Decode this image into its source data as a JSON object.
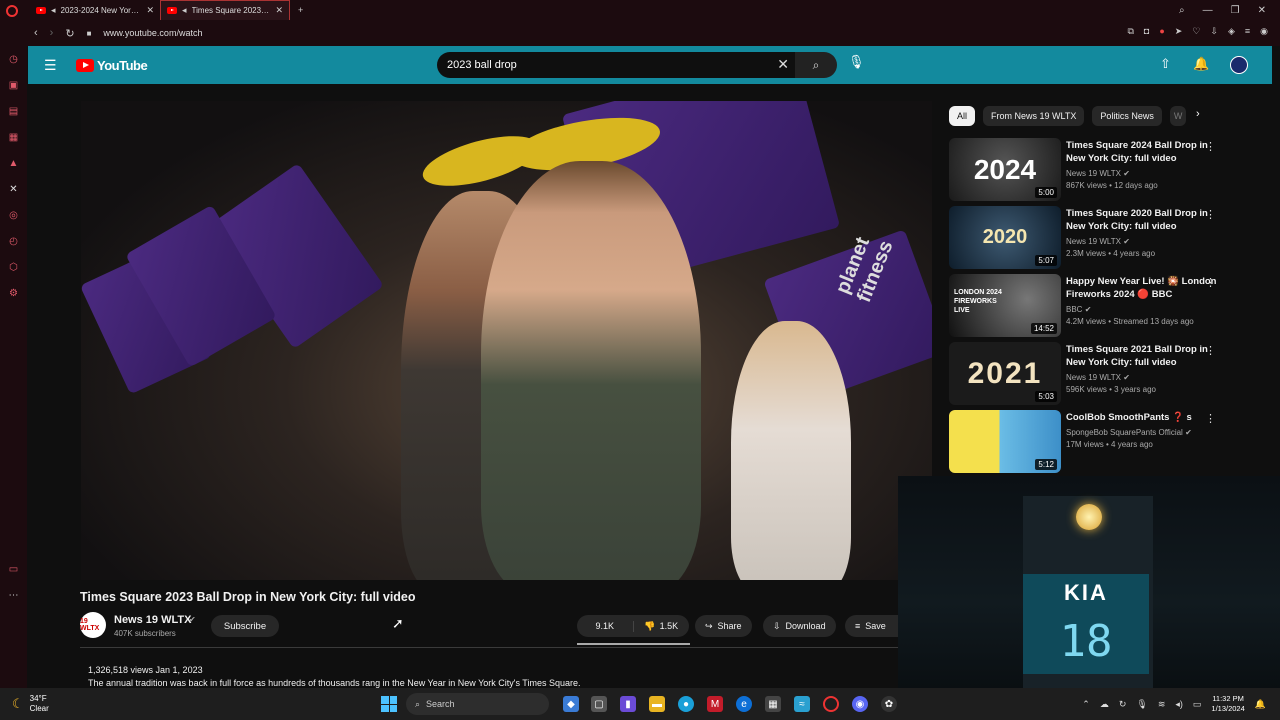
{
  "browser": {
    "tabs": [
      {
        "title": "2023-2024 New York City",
        "active": false
      },
      {
        "title": "Times Square 2023 Ball",
        "active": true
      }
    ],
    "new_tab": "+",
    "url": "www.youtube.com/watch"
  },
  "youtube": {
    "logo_text": "YouTube",
    "search_value": "2023 ball drop",
    "video": {
      "title": "Times Square 2023 Ball Drop in New York City: full video",
      "player_caption": "planet fitness",
      "channel": "News 19 WLTX",
      "channel_avatar_text": "19 WLTX",
      "subscribers": "407K subscribers",
      "subscribe_label": "Subscribe",
      "likes": "9.1K",
      "dislikes": "1.5K",
      "share_label": "Share",
      "download_label": "Download",
      "save_label": "Save",
      "views_date": "1,326,518 views  Jan 1, 2023",
      "description": "The annual tradition was back in full force as hundreds of thousands rang in the New Year in New York City's Times Square."
    },
    "chips": [
      "All",
      "From News 19 WLTX",
      "Politics News",
      "W"
    ],
    "recommendations": [
      {
        "title": "Times Square 2024 Ball Drop in New York City: full video",
        "channel": "News 19 WLTX",
        "meta": "867K views • 12 days ago",
        "duration": "5:00",
        "thumb_text": "2024",
        "thumb_color": "#2b2a2c"
      },
      {
        "title": "Times Square 2020 Ball Drop in New York City: full video",
        "channel": "News 19 WLTX",
        "meta": "2.3M views • 4 years ago",
        "duration": "5:07",
        "thumb_text": "2020",
        "thumb_color": "#1e3c57"
      },
      {
        "title": "Happy New Year Live! 🎇 London Fireworks 2024 🔴 BBC",
        "channel": "BBC",
        "meta": "4.2M views • Streamed 13 days ago",
        "duration": "14:52",
        "thumb_text": "LONDON 2024 FIREWORKS LIVE",
        "thumb_color": "#151515"
      },
      {
        "title": "Times Square 2021 Ball Drop in New York City: full video",
        "channel": "News 19 WLTX",
        "meta": "596K views • 3 years ago",
        "duration": "5:03",
        "thumb_text": "2021",
        "thumb_color": "#222"
      },
      {
        "title": "CoolBob SmoothPants ❓ s",
        "channel": "SpongeBob SquarePants Official",
        "meta": "17M views • 4 years ago",
        "duration": "5:12",
        "thumb_text": "",
        "thumb_color": "#3da0d8"
      }
    ]
  },
  "miniplayer": {
    "logo": "KIA",
    "count": "18"
  },
  "taskbar": {
    "temp": "34°F",
    "condition": "Clear",
    "search_placeholder": "Search",
    "time": "11:32 PM",
    "date": "1/13/2024"
  },
  "colors": {
    "header": "#138a9e",
    "accent": "#ff0000",
    "rail": "#e05a6a"
  }
}
